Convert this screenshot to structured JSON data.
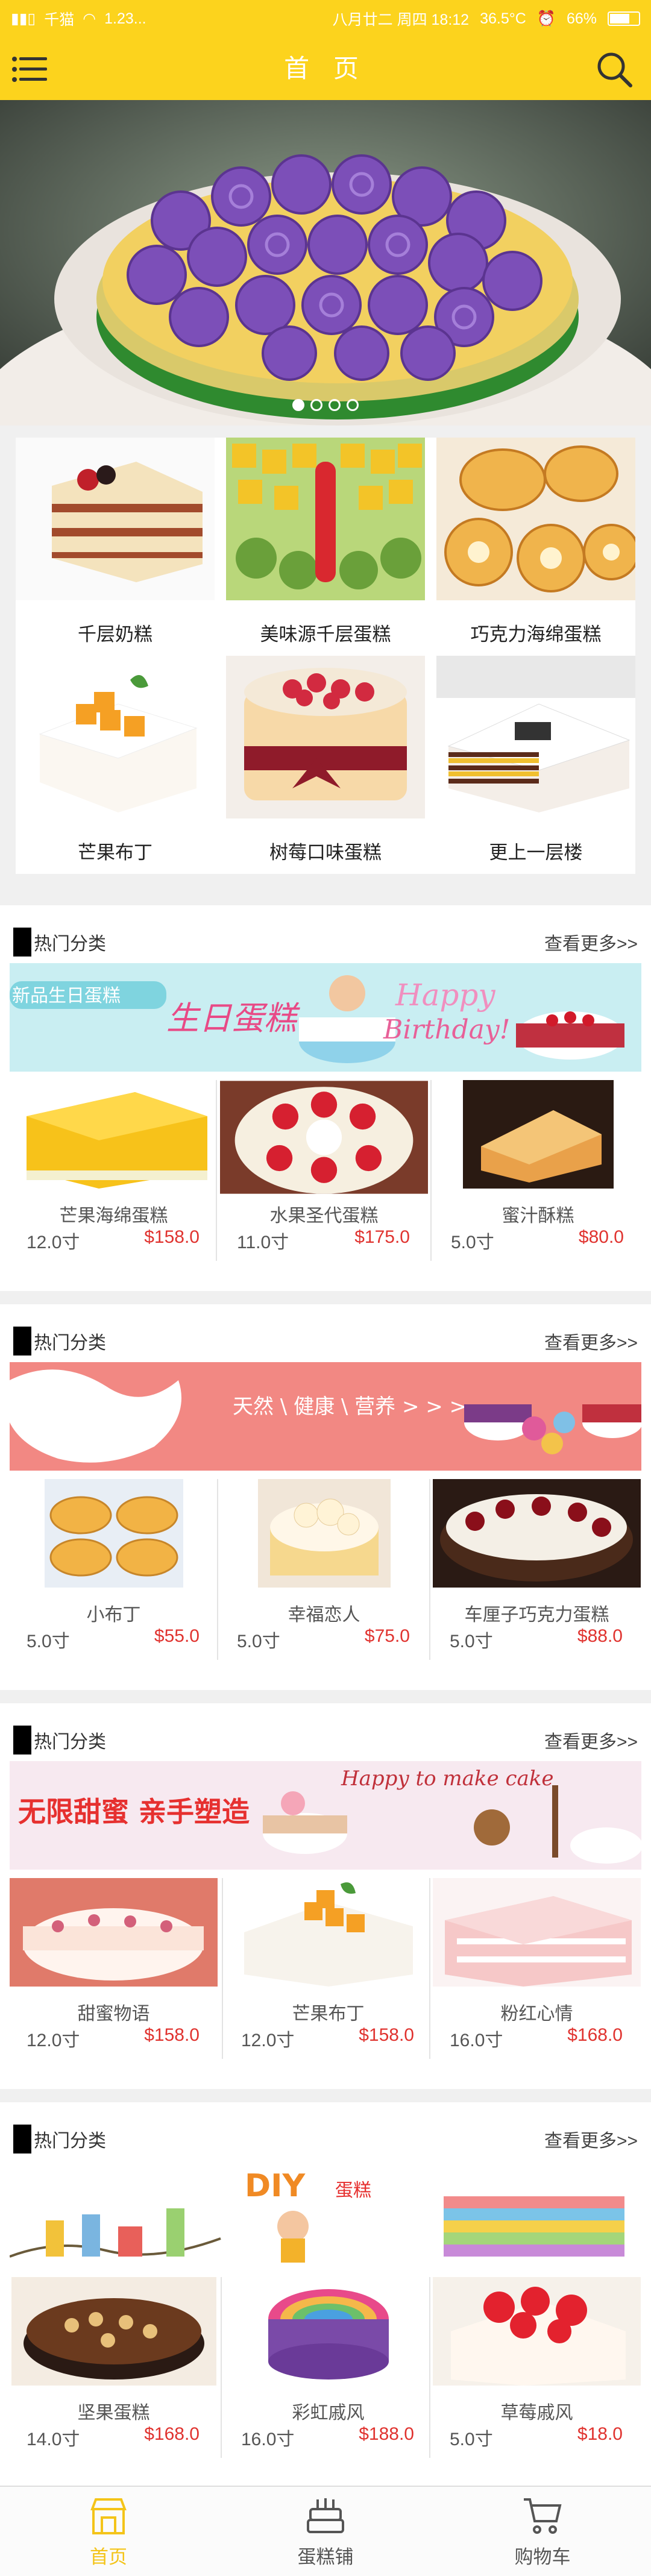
{
  "status_bar": {
    "carrier": "千猫",
    "network": "1.23...",
    "date": "八月廿二 周四 18:12",
    "temperature": "36.5°C",
    "battery": "66%"
  },
  "header": {
    "title": "首 页"
  },
  "categories": [
    {
      "label": "千层奶糕"
    },
    {
      "label": "美味源千层蛋糕"
    },
    {
      "label": "巧克力海绵蛋糕"
    },
    {
      "label": "芒果布丁"
    },
    {
      "label": "树莓口味蛋糕"
    },
    {
      "label": "更上一层楼"
    }
  ],
  "sections": [
    {
      "title": "热门分类",
      "more": "查看更多>>",
      "banner_text": {
        "main": "新品生日蛋糕",
        "script": "生日蛋糕",
        "happy": "Happy",
        "birthday": "Birthday!"
      },
      "products": [
        {
          "name": "芒果海绵蛋糕",
          "size": "12.0寸",
          "price": "$158.0"
        },
        {
          "name": "水果圣代蛋糕",
          "size": "11.0寸",
          "price": "$175.0"
        },
        {
          "name": "蜜汁酥糕",
          "size": "5.0寸",
          "price": "$80.0"
        }
      ]
    },
    {
      "title": "热门分类",
      "more": "查看更多>>",
      "banner_text": {
        "main": "天然 \\ 健康 \\ 营养 > > >"
      },
      "products": [
        {
          "name": "小布丁",
          "size": "5.0寸",
          "price": "$55.0"
        },
        {
          "name": "幸福恋人",
          "size": "5.0寸",
          "price": "$75.0"
        },
        {
          "name": "车厘子巧克力蛋糕",
          "size": "5.0寸",
          "price": "$88.0"
        }
      ]
    },
    {
      "title": "热门分类",
      "more": "查看更多>>",
      "banner_text": {
        "main": "无限甜蜜 亲手塑造",
        "script": "Happy to make cake"
      },
      "products": [
        {
          "name": "甜蜜物语",
          "size": "12.0寸",
          "price": "$158.0"
        },
        {
          "name": "芒果布丁",
          "size": "12.0寸",
          "price": "$158.0"
        },
        {
          "name": "粉红心情",
          "size": "16.0寸",
          "price": "$168.0"
        }
      ]
    },
    {
      "title": "热门分类",
      "more": "查看更多>>",
      "banner_text": {
        "diy": "DIY",
        "cake": "蛋糕"
      },
      "products": [
        {
          "name": "坚果蛋糕",
          "size": "14.0寸",
          "price": "$168.0"
        },
        {
          "name": "彩虹戚风",
          "size": "16.0寸",
          "price": "$188.0"
        },
        {
          "name": "草莓戚风",
          "size": "5.0寸",
          "price": "$18.0"
        }
      ]
    }
  ],
  "tabbar": [
    {
      "label": "首页",
      "icon": "shop-icon",
      "active": true
    },
    {
      "label": "蛋糕铺",
      "icon": "cake-icon",
      "active": false
    },
    {
      "label": "购物车",
      "icon": "cart-icon",
      "active": false
    }
  ],
  "colors": {
    "brand": "#fcd31d",
    "price": "#e0332f",
    "active_tab": "#f4c419"
  }
}
